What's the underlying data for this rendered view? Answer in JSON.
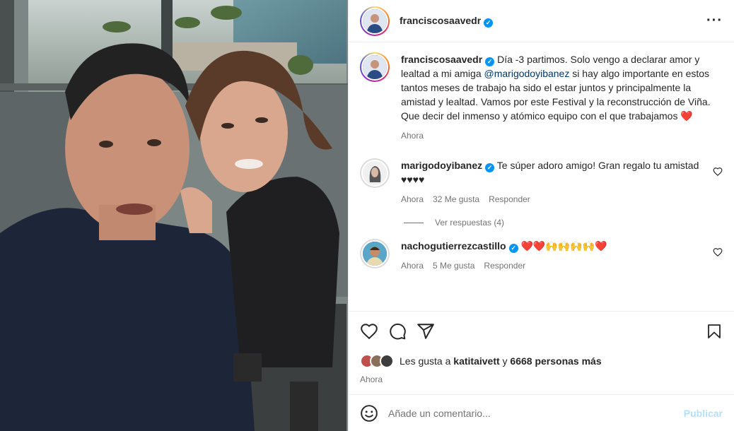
{
  "post": {
    "author": "franciscosaavedr",
    "caption_parts": {
      "before_mention": "Día -3 partimos. Solo vengo a declarar amor y lealtad a mi amiga ",
      "mention": "@marigodoyibanez",
      "after_mention": " si hay algo importante en estos tantos meses de trabajo ha sido el estar juntos y principalmente la amistad y lealtad. Vamos por este Festival y la reconstrucción de Viña. Que decir del inmenso y atómico equipo con el que trabajamos ",
      "emoji": "❤️"
    },
    "caption_time": "Ahora"
  },
  "comments": [
    {
      "user": "marigodoyibanez",
      "text": "Te súper adoro amigo! Gran regalo tu amistad ♥♥♥♥",
      "time": "Ahora",
      "likes": "32 Me gusta",
      "reply": "Responder",
      "view_replies": "Ver respuestas (4)"
    },
    {
      "user": "nachogutierrezcastillo",
      "text": "❤️❤️🙌🙌🙌🙌❤️",
      "time": "Ahora",
      "likes": "5 Me gusta",
      "reply": "Responder"
    }
  ],
  "likes_bar": {
    "prefix": "Les gusta a ",
    "user": "katitaivett",
    "middle": " y ",
    "others": "6668 personas más",
    "time": "Ahora"
  },
  "composer": {
    "placeholder": "Añade un comentario...",
    "publish": "Publicar"
  },
  "icons": {
    "more": "more-options-icon",
    "like": "heart-icon",
    "comment": "comment-icon",
    "share": "share-icon",
    "save": "bookmark-icon",
    "emoji": "emoji-icon"
  },
  "colors": {
    "verified": "#0095f6",
    "publish_disabled": "#b2dffc",
    "link": "#00376b",
    "meta": "#737373"
  }
}
